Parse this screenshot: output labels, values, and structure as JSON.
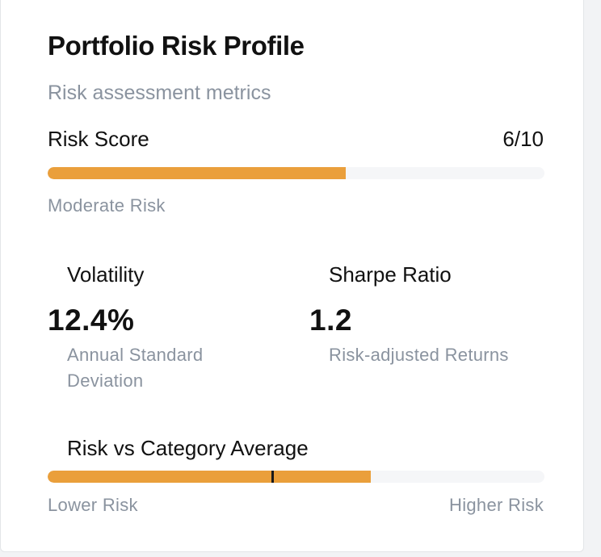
{
  "card": {
    "title": "Portfolio Risk Profile",
    "subtitle": "Risk assessment metrics"
  },
  "risk_score": {
    "label": "Risk Score",
    "value_text": "6/10",
    "fill_fraction": 0.6,
    "level": "Moderate Risk"
  },
  "metrics": [
    {
      "label": "Volatility",
      "value": "12.4%",
      "description": "Annual Standard Deviation"
    },
    {
      "label": "Sharpe Ratio",
      "value": "1.2",
      "description": "Risk-adjusted Returns"
    }
  ],
  "category_comparison": {
    "label": "Risk vs Category Average",
    "fill_fraction": 0.65,
    "average_marker_fraction": 0.45,
    "low_label": "Lower Risk",
    "high_label": "Higher Risk"
  },
  "colors": {
    "accent": "#ea9f3b",
    "track": "#f5f6f8",
    "marker": "#1a1a1a",
    "muted_text": "#8a939f"
  }
}
